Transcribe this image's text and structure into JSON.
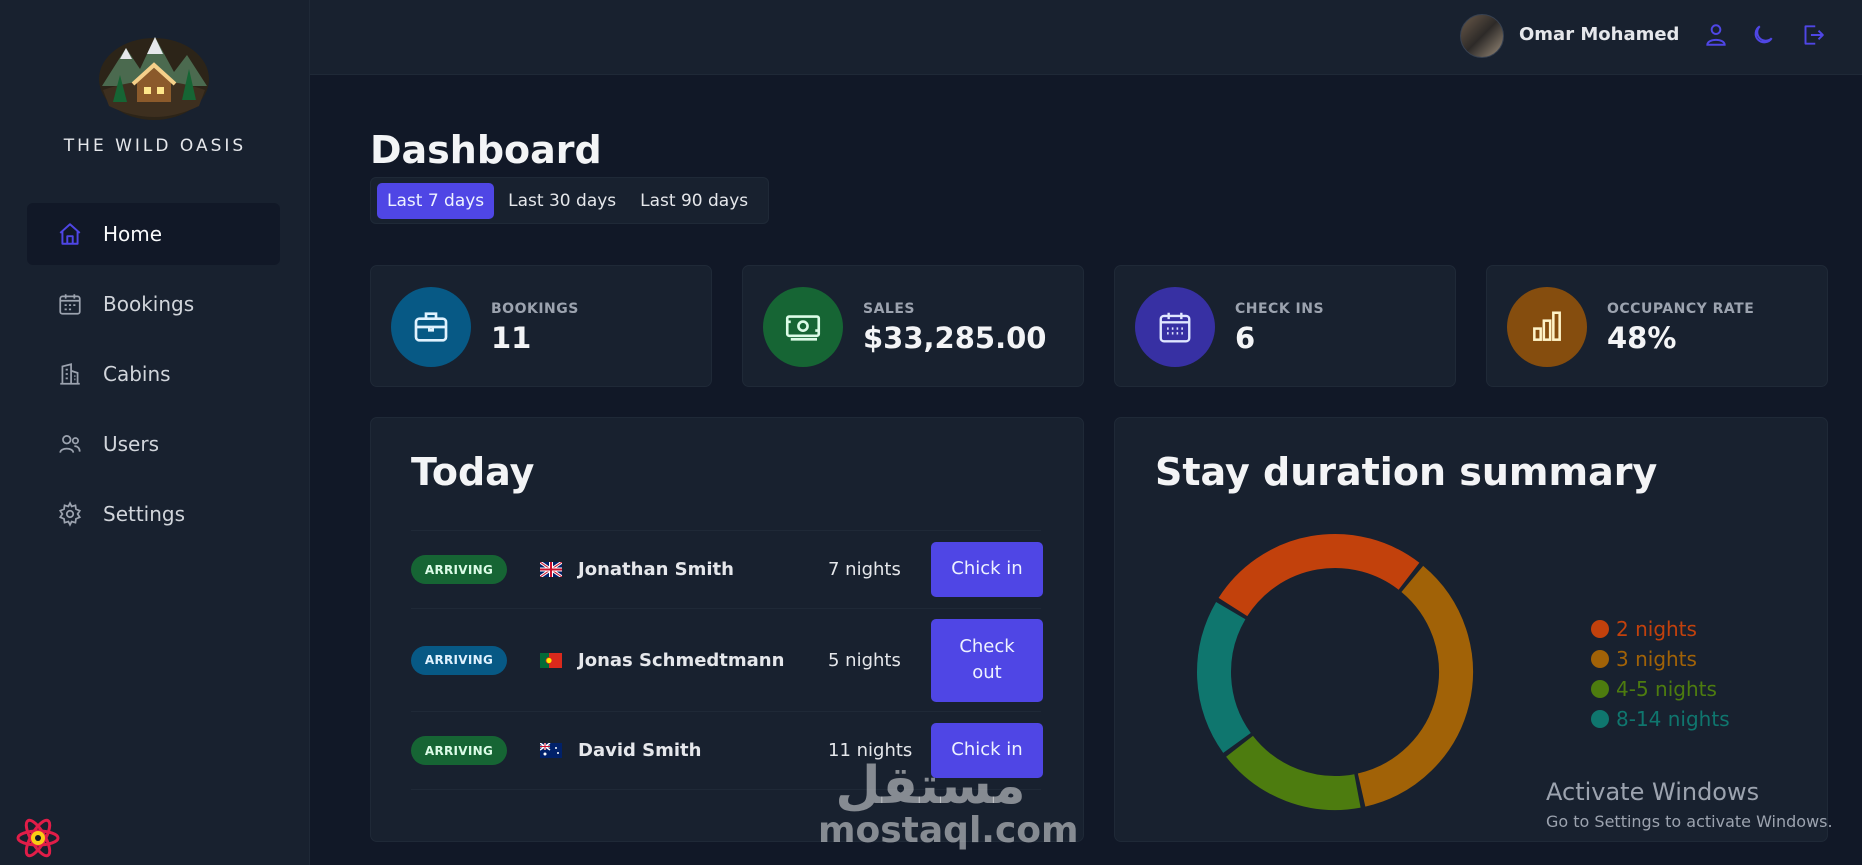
{
  "brand": {
    "name": "THE WILD OASIS"
  },
  "sidebar": {
    "items": [
      {
        "label": "Home",
        "icon": "home-icon",
        "active": true
      },
      {
        "label": "Bookings",
        "icon": "calendar-icon",
        "active": false
      },
      {
        "label": "Cabins",
        "icon": "building-icon",
        "active": false
      },
      {
        "label": "Users",
        "icon": "users-icon",
        "active": false
      },
      {
        "label": "Settings",
        "icon": "gear-icon",
        "active": false
      }
    ]
  },
  "header": {
    "username": "Omar Mohamed",
    "icons": [
      "user-icon",
      "moon-icon",
      "logout-icon"
    ]
  },
  "dashboard": {
    "title": "Dashboard",
    "filters": [
      {
        "label": "Last 7 days",
        "active": true
      },
      {
        "label": "Last 30 days",
        "active": false
      },
      {
        "label": "Last 90 days",
        "active": false
      }
    ]
  },
  "stats": [
    {
      "label": "BOOKINGS",
      "value": "11",
      "icon": "briefcase-icon",
      "color": "#075985"
    },
    {
      "label": "SALES",
      "value": "$33,285.00",
      "icon": "banknotes-icon",
      "color": "#166534"
    },
    {
      "label": "CHECK INS",
      "value": "6",
      "icon": "calendar-days-icon",
      "color": "#3730a3"
    },
    {
      "label": "OCCUPANCY RATE",
      "value": "48%",
      "icon": "chart-bar-icon",
      "color": "#854d0e"
    }
  ],
  "today": {
    "title": "Today",
    "rows": [
      {
        "status": "ARRIVING",
        "status_color": "#166534",
        "flag": "uk-flag-icon",
        "guest": "Jonathan Smith",
        "nights": "7 nights",
        "action": "Chick in"
      },
      {
        "status": "ARRIVING",
        "status_color": "#075985",
        "flag": "portugal-flag-icon",
        "guest": "Jonas Schmedtmann",
        "nights": "5 nights",
        "action": "Check out"
      },
      {
        "status": "ARRIVING",
        "status_color": "#166534",
        "flag": "australia-flag-icon",
        "guest": "David Smith",
        "nights": "11 nights",
        "action": "Chick in"
      }
    ]
  },
  "stay_duration": {
    "title": "Stay duration summary"
  },
  "chart_data": {
    "type": "pie",
    "variant": "donut",
    "title": "Stay duration summary",
    "series": [
      {
        "name": "2 nights",
        "value": 27,
        "color": "#c2410c"
      },
      {
        "name": "3 nights",
        "value": 36,
        "color": "#a16207"
      },
      {
        "name": "4-5 nights",
        "value": 18,
        "color": "#4d7c0f"
      },
      {
        "name": "8-14 nights",
        "value": 19,
        "color": "#0f766e"
      }
    ],
    "legend_position": "right"
  },
  "watermarks": {
    "windows_title": "Activate Windows",
    "windows_subtitle": "Go to Settings to activate Windows.",
    "site_ar": "مستقل",
    "site_en": "mostaql.com"
  },
  "colors": {
    "accent": "#4f46e5",
    "background": "#111827",
    "surface": "#18212f"
  }
}
